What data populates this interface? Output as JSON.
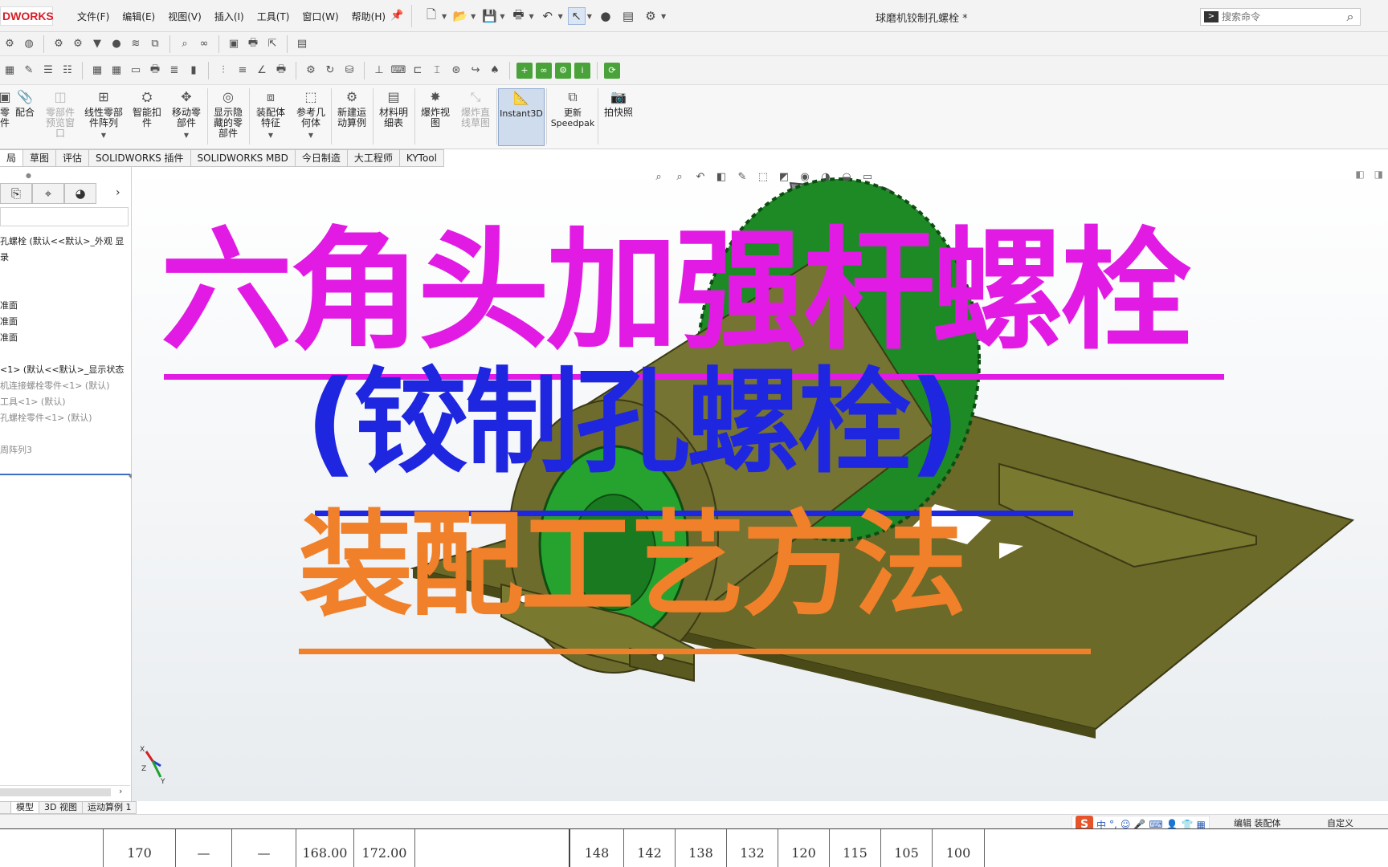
{
  "app": {
    "logo_text": "DWORKS",
    "document_title": "球磨机铰制孔螺栓 *"
  },
  "menu": [
    "文件(F)",
    "编辑(E)",
    "视图(V)",
    "插入(I)",
    "工具(T)",
    "窗口(W)",
    "帮助(H)"
  ],
  "search": {
    "placeholder": "搜索命令"
  },
  "command_manager": [
    {
      "label": "零\n件"
    },
    {
      "label": "配合"
    },
    {
      "label": "零部件\n预览窗\n口",
      "disabled": true
    },
    {
      "label": "线性零部\n件阵列"
    },
    {
      "label": "智能扣\n件"
    },
    {
      "label": "移动零\n部件"
    },
    {
      "label": "显示隐\n藏的零\n部件"
    },
    {
      "label": "装配体\n特征"
    },
    {
      "label": "参考几\n何体"
    },
    {
      "label": "新建运\n动算例"
    },
    {
      "label": "材料明\n细表"
    },
    {
      "label": "爆炸视\n图"
    },
    {
      "label": "爆炸直\n线草图",
      "disabled": true
    },
    {
      "label": "Instant3D",
      "active": true
    },
    {
      "label": "更新\nSpeedpak"
    },
    {
      "label": "拍快照"
    }
  ],
  "tabs": [
    "局",
    "草图",
    "评估",
    "SOLIDWORKS 插件",
    "SOLIDWORKS MBD",
    "今日制造",
    "大工程师",
    "KYTool"
  ],
  "feature_tree": [
    {
      "text": "孔螺栓 (默认<<默认>_外观 显",
      "grey": false
    },
    {
      "text": "录",
      "grey": false
    },
    {
      "text": "准面",
      "grey": false
    },
    {
      "text": "准面",
      "grey": false
    },
    {
      "text": "准面",
      "grey": false
    },
    {
      "text": "<1> (默认<<默认>_显示状态",
      "grey": false
    },
    {
      "text": "机连接螺栓零件<1> (默认)",
      "grey": true
    },
    {
      "text": "工具<1> (默认)",
      "grey": true
    },
    {
      "text": "孔螺栓零件<1> (默认)",
      "grey": true
    },
    {
      "text": "周阵列3",
      "grey": true
    }
  ],
  "overlay": {
    "line1": "六角头加强杆螺栓",
    "line2": "(铰制孔螺栓)",
    "line3": "装配工艺方法",
    "color1": "#e21be4",
    "color2": "#1f26e0",
    "color3": "#f0802a"
  },
  "triad": {
    "x": "X",
    "y": "Y",
    "z": "Z"
  },
  "bottom_tabs": [
    "",
    "模型",
    "3D 视图",
    "运动算例 1"
  ],
  "status": {
    "editing": "编辑 装配体",
    "custom": "自定义",
    "ime_zh": "中"
  },
  "table_row": [
    "170",
    "—",
    "—",
    "168.00",
    "172.00",
    "",
    "148",
    "142",
    "138",
    "132",
    "120",
    "115",
    "105",
    "100"
  ],
  "model_colors": {
    "base": "#6b6a28",
    "drum": "#767432",
    "gear": "#1e8a26",
    "motor": "#8e8e8e"
  }
}
